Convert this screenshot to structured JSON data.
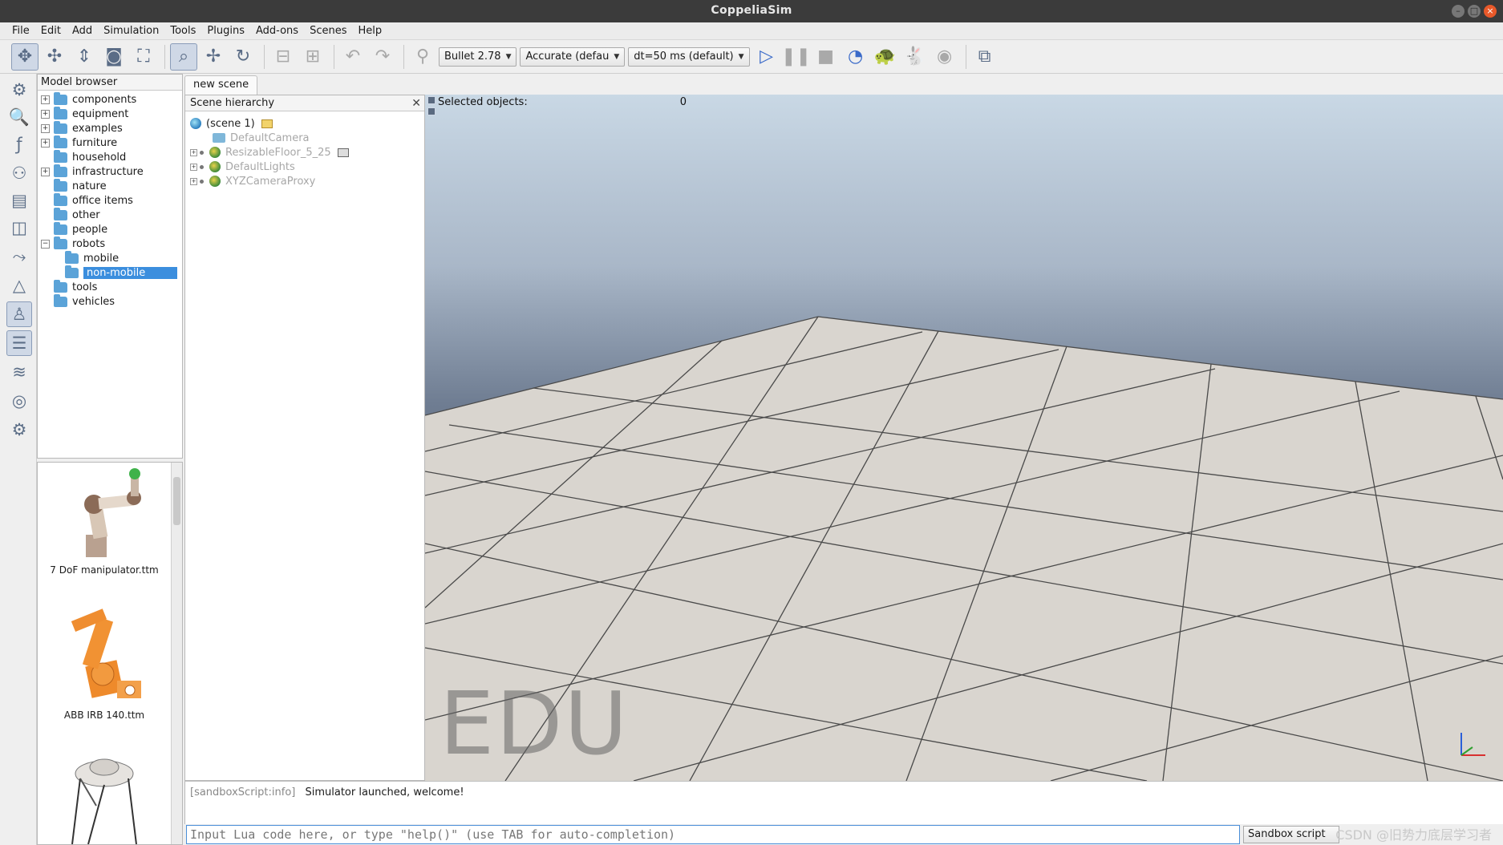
{
  "window": {
    "title": "CoppeliaSim"
  },
  "menu": [
    "File",
    "Edit",
    "Add",
    "Simulation",
    "Tools",
    "Plugins",
    "Add-ons",
    "Scenes",
    "Help"
  ],
  "toolbar": {
    "engine": "Bullet 2.78",
    "accuracy": "Accurate (defau",
    "dt": "dt=50 ms (default)"
  },
  "model_browser": {
    "title": "Model browser",
    "folders": [
      {
        "label": "components",
        "expandable": true,
        "level": 0
      },
      {
        "label": "equipment",
        "expandable": true,
        "level": 0
      },
      {
        "label": "examples",
        "expandable": true,
        "level": 0
      },
      {
        "label": "furniture",
        "expandable": true,
        "level": 0
      },
      {
        "label": "household",
        "expandable": false,
        "level": 0
      },
      {
        "label": "infrastructure",
        "expandable": true,
        "level": 0
      },
      {
        "label": "nature",
        "expandable": false,
        "level": 0
      },
      {
        "label": "office items",
        "expandable": false,
        "level": 0
      },
      {
        "label": "other",
        "expandable": false,
        "level": 0
      },
      {
        "label": "people",
        "expandable": false,
        "level": 0
      },
      {
        "label": "robots",
        "expandable": true,
        "expanded": true,
        "level": 0
      },
      {
        "label": "mobile",
        "expandable": false,
        "level": 1
      },
      {
        "label": "non-mobile",
        "expandable": false,
        "level": 1,
        "selected": true
      },
      {
        "label": "tools",
        "expandable": false,
        "level": 0
      },
      {
        "label": "vehicles",
        "expandable": false,
        "level": 0
      }
    ],
    "thumbnails": [
      {
        "label": "7 DoF manipulator.ttm"
      },
      {
        "label": "ABB IRB 140.ttm"
      },
      {
        "label": ""
      }
    ]
  },
  "scene_tab": {
    "label": "new scene"
  },
  "hierarchy": {
    "title": "Scene hierarchy",
    "root": "(scene 1)",
    "items": [
      "DefaultCamera",
      "ResizableFloor_5_25",
      "DefaultLights",
      "XYZCameraProxy"
    ]
  },
  "viewport": {
    "selected_label": "Selected objects:",
    "selected_count": "0",
    "watermark": "EDU"
  },
  "console": {
    "source": "[sandboxScript:info]",
    "message": "Simulator launched, welcome!",
    "input_placeholder": "Input Lua code here, or type \"help()\" (use TAB for auto-completion)",
    "script_target": "Sandbox script"
  },
  "overlay_text": "CSDN @旧势力底层学习者"
}
